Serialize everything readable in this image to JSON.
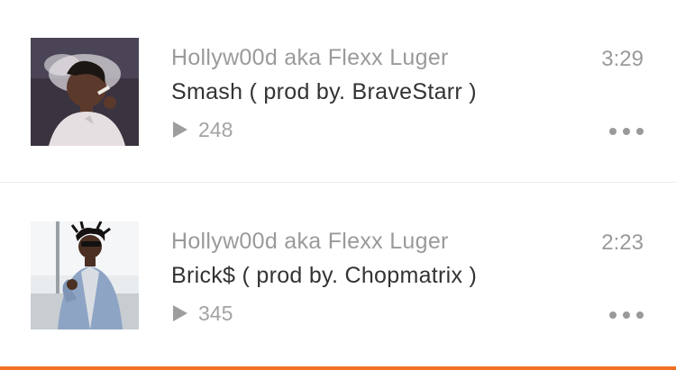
{
  "tracks": [
    {
      "artist": "Hollyw00d aka Flexx Luger",
      "title": "Smash ( prod by. BraveStarr )",
      "plays": "248",
      "duration": "3:29",
      "play_icon": "play-icon",
      "more_icon": "more-icon"
    },
    {
      "artist": "Hollyw00d aka Flexx Luger",
      "title": "Brick$ ( prod by. Chopmatrix )",
      "plays": "345",
      "duration": "2:23",
      "play_icon": "play-icon",
      "more_icon": "more-icon"
    }
  ],
  "colors": {
    "accent": "#f26f23",
    "secondary_text": "#9a9a9a",
    "primary_text": "#333333"
  }
}
